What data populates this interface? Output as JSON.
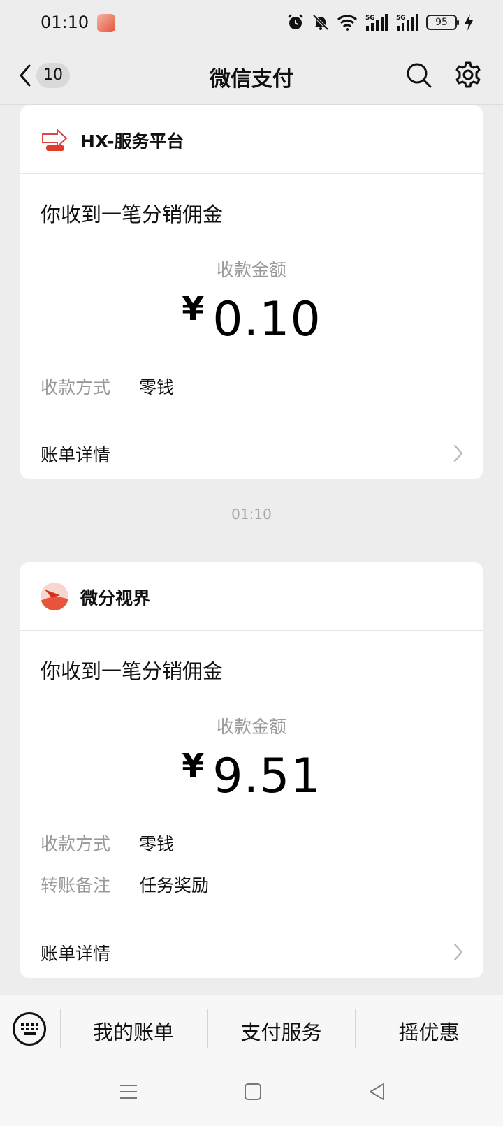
{
  "status_bar": {
    "time": "01:10",
    "battery": "95",
    "signal_labels": [
      "5G",
      "5G"
    ]
  },
  "nav": {
    "unread_count": "10",
    "title": "微信支付"
  },
  "messages": [
    {
      "merchant": "HX-服务平台",
      "title": "你收到一笔分销佣金",
      "amount_label": "收款金额",
      "currency": "¥",
      "amount": "0.10",
      "rows": [
        {
          "label": "收款方式",
          "value": "零钱"
        }
      ],
      "detail_label": "账单详情"
    },
    {
      "merchant": "微分视界",
      "title": "你收到一笔分销佣金",
      "amount_label": "收款金额",
      "currency": "¥",
      "amount": "9.51",
      "rows": [
        {
          "label": "收款方式",
          "value": "零钱"
        },
        {
          "label": "转账备注",
          "value": "任务奖励"
        }
      ],
      "detail_label": "账单详情"
    }
  ],
  "timestamp": "01:10",
  "bottom_menu": {
    "items": [
      "我的账单",
      "支付服务",
      "摇优惠"
    ]
  },
  "icons": {
    "back": "chevron-left-icon",
    "search": "search-icon",
    "settings": "gear-icon",
    "keyboard": "keyboard-icon",
    "chevron": "chevron-right-icon"
  },
  "colors": {
    "background": "#ededed",
    "card": "#ffffff",
    "muted_text": "#999999"
  }
}
